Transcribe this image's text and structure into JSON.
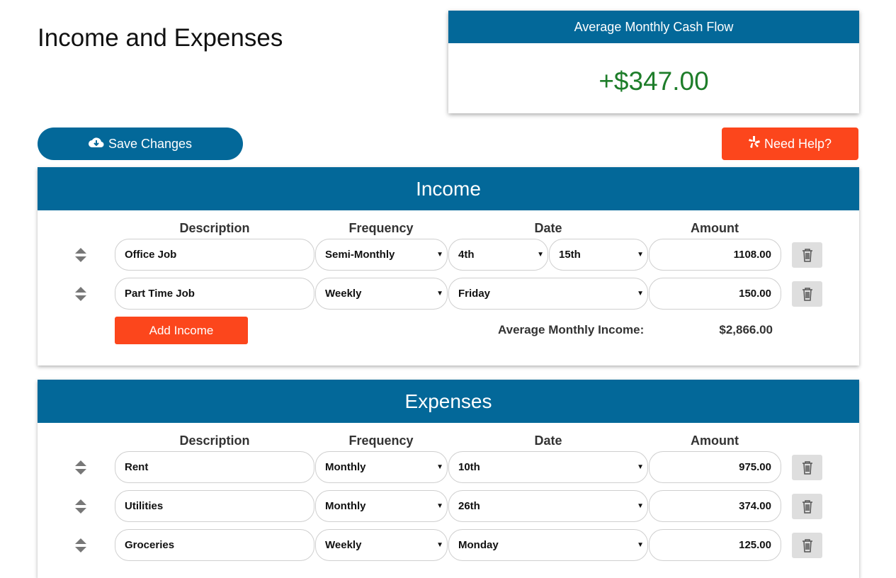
{
  "page": {
    "title": "Income and Expenses"
  },
  "cashflow": {
    "label": "Average Monthly Cash Flow",
    "value": "+$347.00",
    "value_color": "#1e7d2a"
  },
  "toolbar": {
    "save_label": "Save Changes",
    "help_label": "Need Help?"
  },
  "colors": {
    "primary": "#036899",
    "accent": "#fc461c"
  },
  "columns": {
    "description": "Description",
    "frequency": "Frequency",
    "date": "Date",
    "amount": "Amount"
  },
  "income": {
    "title": "Income",
    "rows": [
      {
        "description": "Office Job",
        "frequency": "Semi-Monthly",
        "date1": "4th",
        "date2": "15th",
        "amount": "1108.00"
      },
      {
        "description": "Part Time Job",
        "frequency": "Weekly",
        "date1": "Friday",
        "amount": "150.00"
      }
    ],
    "add_label": "Add Income",
    "avg_label": "Average Monthly Income:",
    "avg_value": "$2,866.00"
  },
  "expenses": {
    "title": "Expenses",
    "rows": [
      {
        "description": "Rent",
        "frequency": "Monthly",
        "date1": "10th",
        "amount": "975.00"
      },
      {
        "description": "Utilities",
        "frequency": "Monthly",
        "date1": "26th",
        "amount": "374.00"
      },
      {
        "description": "Groceries",
        "frequency": "Weekly",
        "date1": "Monday",
        "amount": "125.00"
      }
    ]
  },
  "icons": {
    "save": "cloud-download-icon",
    "help": "yelp-icon",
    "grip": "sort-arrows-icon",
    "delete": "trash-icon",
    "select": "caret-down-icon"
  }
}
